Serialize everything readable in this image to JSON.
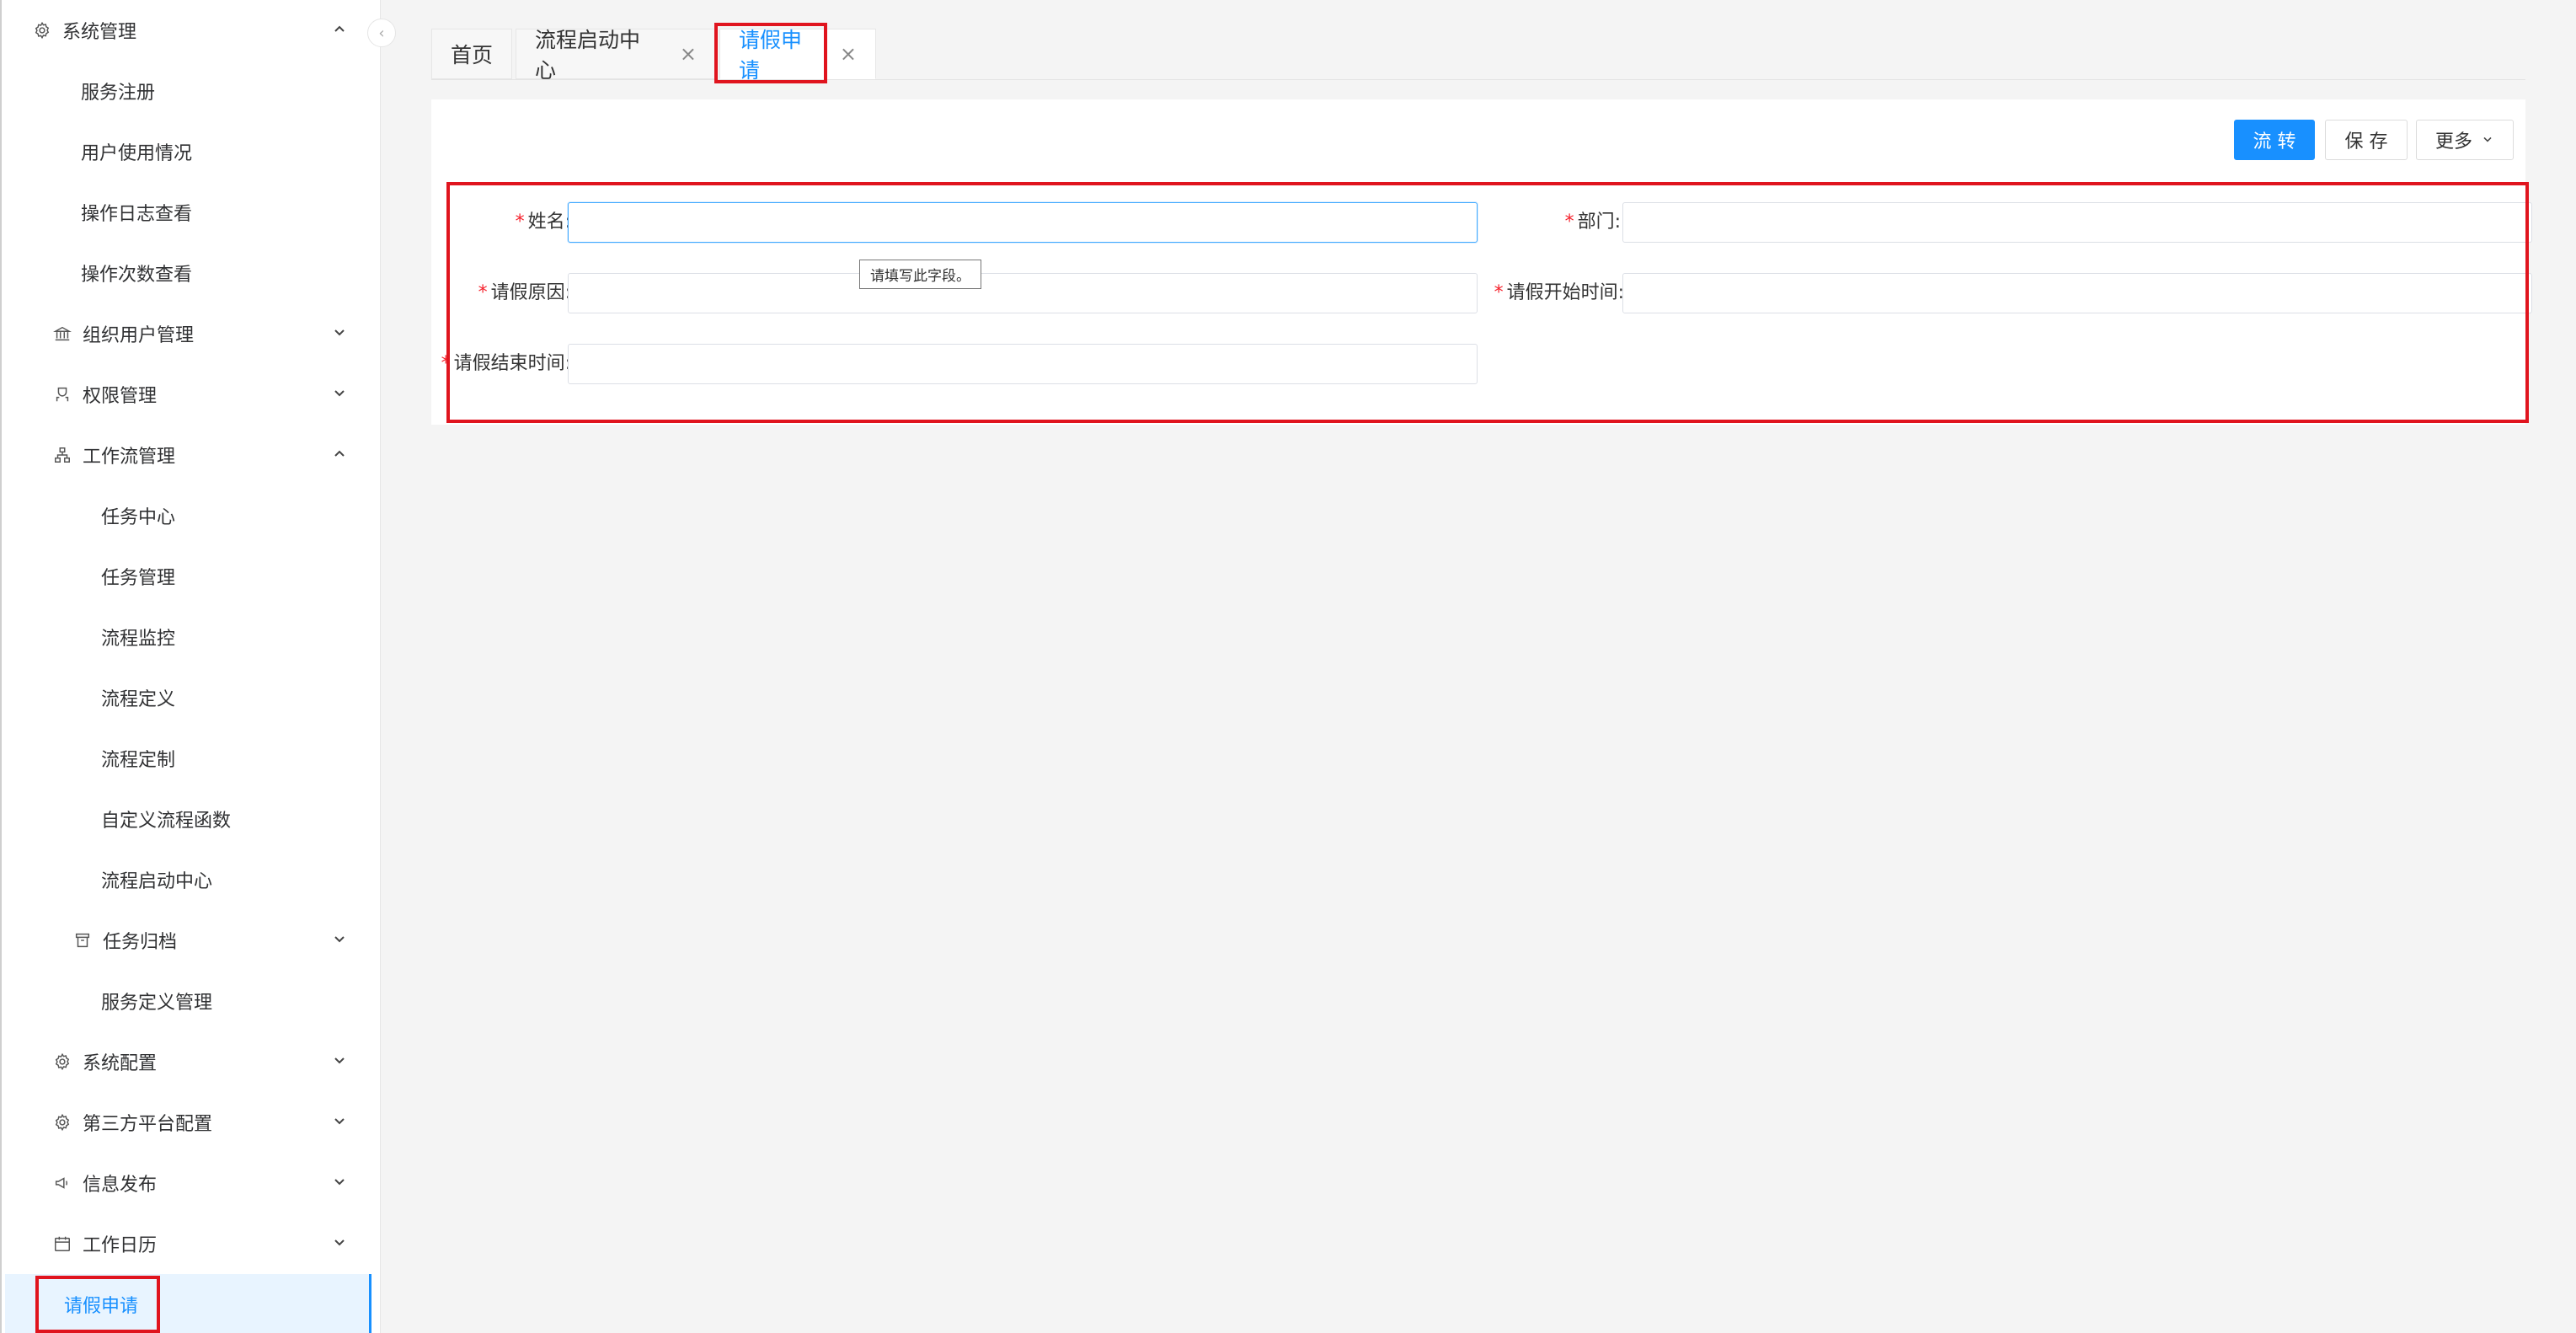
{
  "sidebar": {
    "items": [
      {
        "label": "系统管理",
        "icon": "gear-icon",
        "chevron": "up"
      },
      {
        "label": "服务注册"
      },
      {
        "label": "用户使用情况"
      },
      {
        "label": "操作日志查看"
      },
      {
        "label": "操作次数查看"
      },
      {
        "label": "组织用户管理",
        "icon": "bank-icon",
        "chevron": "down"
      },
      {
        "label": "权限管理",
        "icon": "user-icon",
        "chevron": "down"
      },
      {
        "label": "工作流管理",
        "icon": "workflow-icon",
        "chevron": "up"
      },
      {
        "label": "任务中心"
      },
      {
        "label": "任务管理"
      },
      {
        "label": "流程监控"
      },
      {
        "label": "流程定义"
      },
      {
        "label": "流程定制"
      },
      {
        "label": "自定义流程函数"
      },
      {
        "label": "流程启动中心"
      },
      {
        "label": "任务归档",
        "icon": "archive-icon",
        "chevron": "down"
      },
      {
        "label": "服务定义管理"
      },
      {
        "label": "系统配置",
        "icon": "gear-icon",
        "chevron": "down"
      },
      {
        "label": "第三方平台配置",
        "icon": "gear-icon",
        "chevron": "down"
      },
      {
        "label": "信息发布",
        "icon": "megaphone-icon",
        "chevron": "down"
      },
      {
        "label": "工作日历",
        "icon": "calendar-icon",
        "chevron": "down"
      },
      {
        "label": "请假申请",
        "active": true
      }
    ]
  },
  "tabs": [
    {
      "label": "首页",
      "closable": false
    },
    {
      "label": "流程启动中心",
      "closable": true
    },
    {
      "label": "请假申请",
      "closable": true,
      "active": true
    }
  ],
  "toolbar": {
    "transfer_label": "流 转",
    "save_label": "保 存",
    "more_label": "更多"
  },
  "form": {
    "name_label": "姓名",
    "dept_label": "部门",
    "reason_label": "请假原因",
    "start_label": "请假开始时间",
    "end_label": "请假结束时间",
    "required_mark": "*",
    "colon": ":"
  },
  "tooltip": "请填写此字段。",
  "colors": {
    "accent": "#1890ff",
    "highlight": "#e0141e",
    "required": "#f5222d"
  }
}
